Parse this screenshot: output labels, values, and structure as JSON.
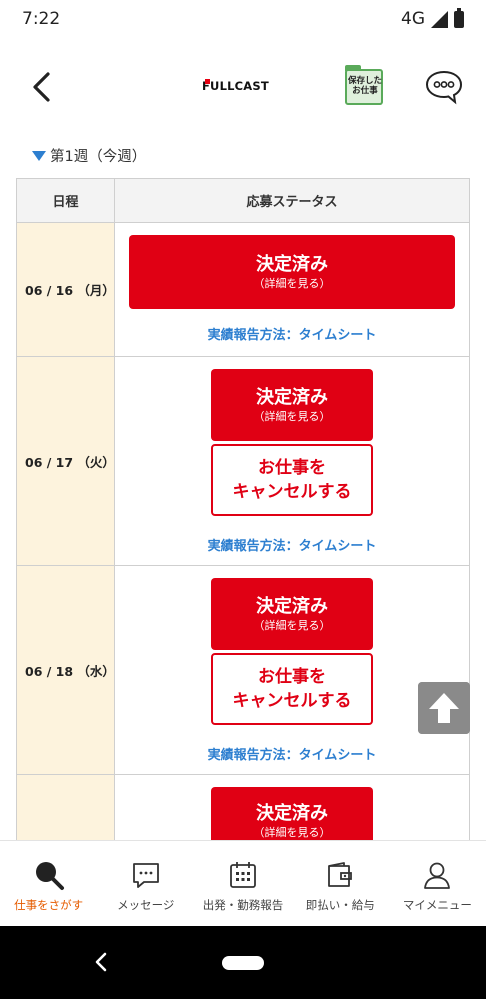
{
  "status_bar": {
    "time": "7:22",
    "network": "4G"
  },
  "header": {
    "logo": "FULLCAST",
    "saved_jobs_line1": "保存した",
    "saved_jobs_line2": "お仕事"
  },
  "week_label": "第1週（今週）",
  "table": {
    "headers": {
      "date": "日程",
      "status": "応募ステータス"
    },
    "rows": [
      {
        "date": "06 / 16 （月）",
        "decided_main": "決定済み",
        "decided_sub": "（詳細を見る）",
        "report": "実績報告方法：タイムシート"
      },
      {
        "date": "06 / 17 （火）",
        "decided_main": "決定済み",
        "decided_sub": "（詳細を見る）",
        "cancel_line1": "お仕事を",
        "cancel_line2": "キャンセルする",
        "report": "実績報告方法：タイムシート"
      },
      {
        "date": "06 / 18 （水）",
        "decided_main": "決定済み",
        "decided_sub": "（詳細を見る）",
        "cancel_line1": "お仕事を",
        "cancel_line2": "キャンセルする",
        "report": "実績報告方法：タイムシート"
      },
      {
        "decided_main": "決定済み",
        "decided_sub": "（詳細を見る）"
      }
    ]
  },
  "bottom_nav": [
    {
      "label": "仕事をさがす",
      "icon": "search-icon",
      "active": true
    },
    {
      "label": "メッセージ",
      "icon": "message-icon"
    },
    {
      "label": "出発・勤務報告",
      "icon": "calendar-icon"
    },
    {
      "label": "即払い・給与",
      "icon": "wallet-icon"
    },
    {
      "label": "マイメニュー",
      "icon": "user-icon"
    }
  ],
  "colors": {
    "brand_red": "#e00014",
    "link_blue": "#2d7fd0",
    "active_orange": "#e65c00",
    "date_bg": "#fdf3dd"
  }
}
